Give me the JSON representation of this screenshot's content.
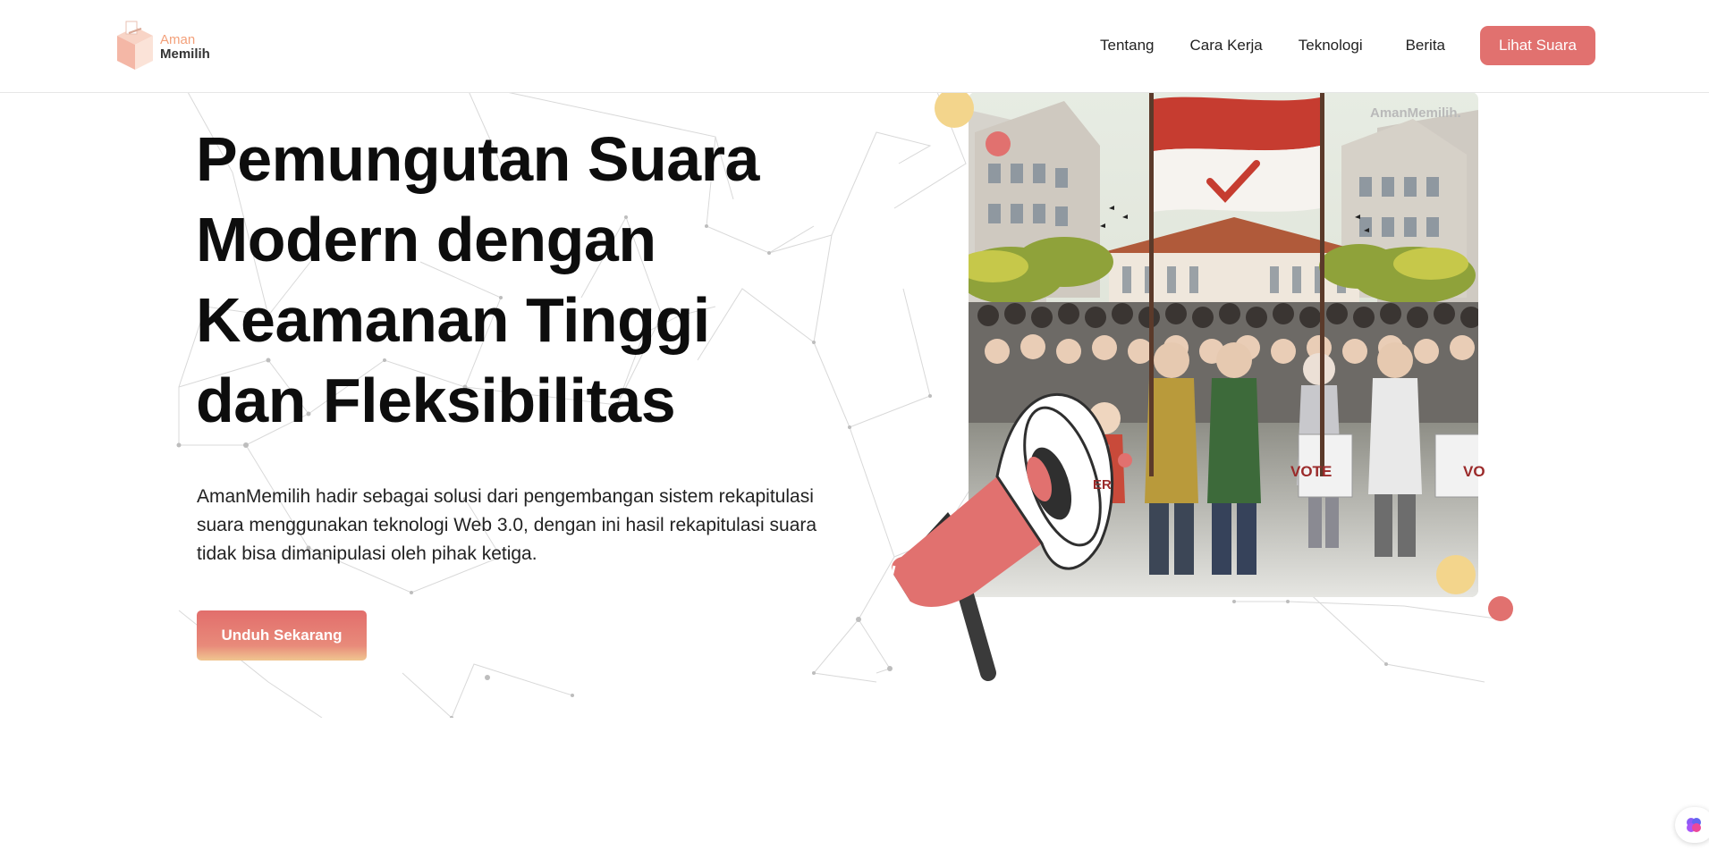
{
  "brand": {
    "line1": "Aman",
    "line2": "Memilih",
    "colors": {
      "primary": "#e1716f",
      "accent_yellow": "#f3d58c",
      "logo_peach": "#f3a07a"
    }
  },
  "nav": {
    "links": [
      "Tentang",
      "Cara Kerja",
      "Teknologi",
      "Berita"
    ],
    "cta": "Lihat Suara"
  },
  "hero": {
    "title": "Pemungutan Suara Modern dengan Keamanan Tinggi dan Fleksibilitas",
    "description": "AmanMemilih hadir sebagai solusi dari pengembangan sistem rekapitulasi suara menggunakan teknologi Web 3.0, dengan ini hasil rekapitulasi suara tidak bisa dimanipulasi oleh pihak ketiga.",
    "cta": "Unduh Sekarang"
  },
  "illustration": {
    "watermark": "AmanMemilih.",
    "sign_vote": "VOTE",
    "sign_vote_partial": "VO",
    "sign_voter_partial": "ER"
  },
  "icons": {
    "logo": "ballot-box-icon",
    "megaphone": "megaphone-icon",
    "floating": "brain-icon"
  }
}
